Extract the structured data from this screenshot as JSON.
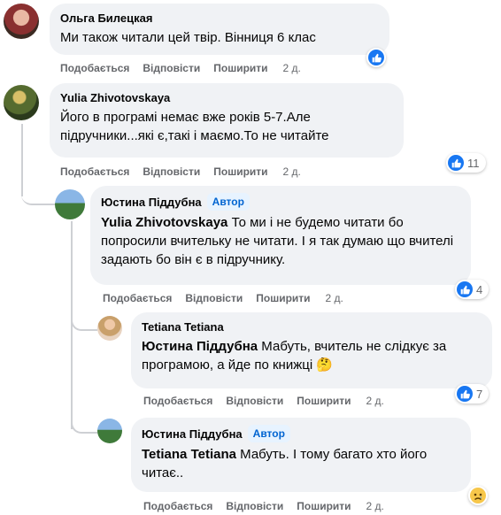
{
  "actions": {
    "like": "Подобається",
    "reply": "Відповісти",
    "share": "Поширити"
  },
  "comments": [
    {
      "author": "Ольга Билецкая",
      "text": "Ми також читали цей твір. Вінниця 6 клас",
      "time": "2 д.",
      "reaction_count": ""
    },
    {
      "author": "Yulia Zhivotovskaya",
      "text": "Його в програмі немає вже років 5-7.Але підручники...які є,такі і маємо.То не читайте",
      "time": "2 д.",
      "reaction_count": "11"
    },
    {
      "author": "Юстина Піддубна",
      "badge": "Автор",
      "mention": "Yulia Zhivotovskaya",
      "text": " То ми і не будемо читати бо попросили вчительку не читати. І я так думаю що вчителі задають бо він є в підручнику.",
      "time": "2 д.",
      "reaction_count": "4"
    },
    {
      "author": "Tetiana Tetiana",
      "mention": "Юстина Піддубна",
      "text": " Мабуть, вчитель не слідкує за програмою, а йде по книжці 🤔",
      "time": "2 д.",
      "reaction_count": "7"
    },
    {
      "author": "Юстина Піддубна",
      "badge": "Автор",
      "mention": "Tetiana Tetiana",
      "text": " Мабуть. І тому багато хто його читає..",
      "time": "2 д.",
      "reaction_count": ""
    }
  ],
  "colors": {
    "bubble": "#f0f2f5",
    "like": "#1877f2",
    "badge_text": "#0064d1",
    "muted": "#65676b"
  },
  "icons": [
    "like-icon",
    "sad-emoji-icon"
  ]
}
